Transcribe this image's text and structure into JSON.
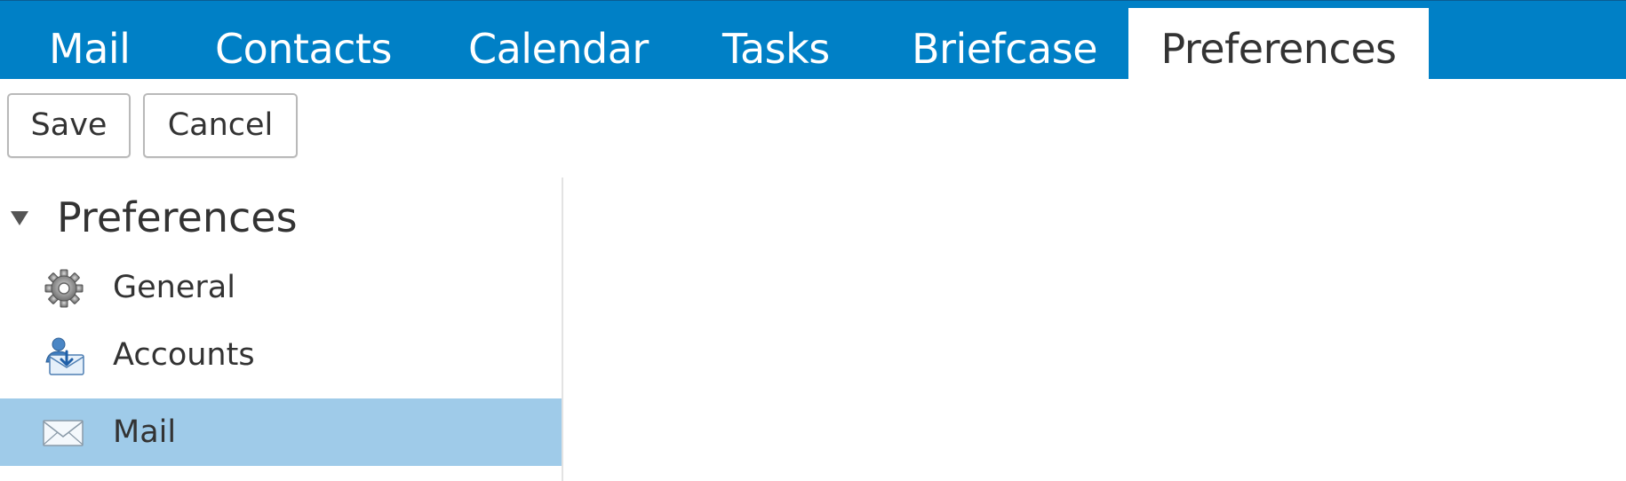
{
  "app_tabs": [
    {
      "label": "Mail"
    },
    {
      "label": "Contacts"
    },
    {
      "label": "Calendar"
    },
    {
      "label": "Tasks"
    },
    {
      "label": "Briefcase"
    },
    {
      "label": "Preferences",
      "active": true
    }
  ],
  "toolbar": {
    "save_label": "Save",
    "cancel_label": "Cancel"
  },
  "tree": {
    "root_label": "Preferences",
    "root_expanded": true,
    "items": [
      {
        "label": "General",
        "icon": "gear-icon"
      },
      {
        "label": "Accounts",
        "icon": "accounts-icon"
      },
      {
        "label": "Mail",
        "icon": "envelope-icon",
        "selected": true
      }
    ]
  },
  "colors": {
    "tab_bar": "#0080c6",
    "selected_item": "#9fcbe9",
    "text": "#333333"
  }
}
